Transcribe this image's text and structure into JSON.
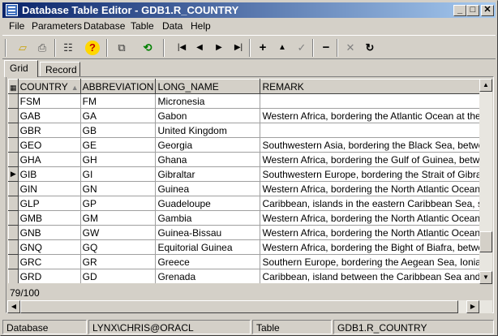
{
  "window": {
    "title": "Database Table Editor - GDB1.R_COUNTRY"
  },
  "menu": [
    "File",
    "Parameters",
    "Database",
    "Table",
    "Data",
    "Help"
  ],
  "toolbar": {
    "buttons": [
      "open-folder-icon",
      "print-icon",
      "properties-icon",
      "help-icon",
      "copy-icon",
      "refresh-icon",
      "first-record-icon",
      "prior-record-icon",
      "next-record-icon",
      "last-record-icon",
      "insert-record-icon",
      "edit-record-icon",
      "post-record-icon",
      "delete-record-icon",
      "cancel-edit-icon",
      "refresh-data-icon"
    ]
  },
  "tabs": [
    "Grid",
    "Record"
  ],
  "grid": {
    "columns": [
      "COUNTRY",
      "ABBREVIATION",
      "LONG_NAME",
      "REMARK"
    ],
    "rows": [
      {
        "country": "FSM",
        "abbr": "FM",
        "long": "Micronesia",
        "remark": ""
      },
      {
        "country": "GAB",
        "abbr": "GA",
        "long": "Gabon",
        "remark": "Western Africa, bordering the Atlantic Ocean at the"
      },
      {
        "country": "GBR",
        "abbr": "GB",
        "long": "United Kingdom",
        "remark": ""
      },
      {
        "country": "GEO",
        "abbr": "GE",
        "long": "Georgia",
        "remark": "Southwestern Asia, bordering the Black Sea, betwe"
      },
      {
        "country": "GHA",
        "abbr": "GH",
        "long": "Ghana",
        "remark": "Western Africa, bordering the Gulf of Guinea, betwe"
      },
      {
        "country": "GIB",
        "abbr": "GI",
        "long": "Gibraltar",
        "remark": "Southwestern Europe, bordering the Strait of Gibralt"
      },
      {
        "country": "GIN",
        "abbr": "GN",
        "long": "Guinea",
        "remark": "Western Africa, bordering the North Atlantic Ocean"
      },
      {
        "country": "GLP",
        "abbr": "GP",
        "long": "Guadeloupe",
        "remark": "Caribbean, islands in the eastern Caribbean Sea, so"
      },
      {
        "country": "GMB",
        "abbr": "GM",
        "long": "Gambia",
        "remark": "Western Africa, bordering the North Atlantic Ocean"
      },
      {
        "country": "GNB",
        "abbr": "GW",
        "long": "Guinea-Bissau",
        "remark": "Western Africa, bordering the North Atlantic Ocean"
      },
      {
        "country": "GNQ",
        "abbr": "GQ",
        "long": "Equitorial Guinea",
        "remark": "Western Africa, bordering the Bight of Biafra, betwe"
      },
      {
        "country": "GRC",
        "abbr": "GR",
        "long": "Greece",
        "remark": "Southern Europe, bordering the Aegean Sea, Ionian"
      },
      {
        "country": "GRD",
        "abbr": "GD",
        "long": "Grenada",
        "remark": "Caribbean, island between the Caribbean Sea and A"
      }
    ],
    "current_row": 5
  },
  "record_counter": "79/100",
  "status": {
    "mode": "Database",
    "connection": "LYNX\\CHRIS@ORACL",
    "object_type": "Table",
    "object_name": "GDB1.R_COUNTRY"
  }
}
